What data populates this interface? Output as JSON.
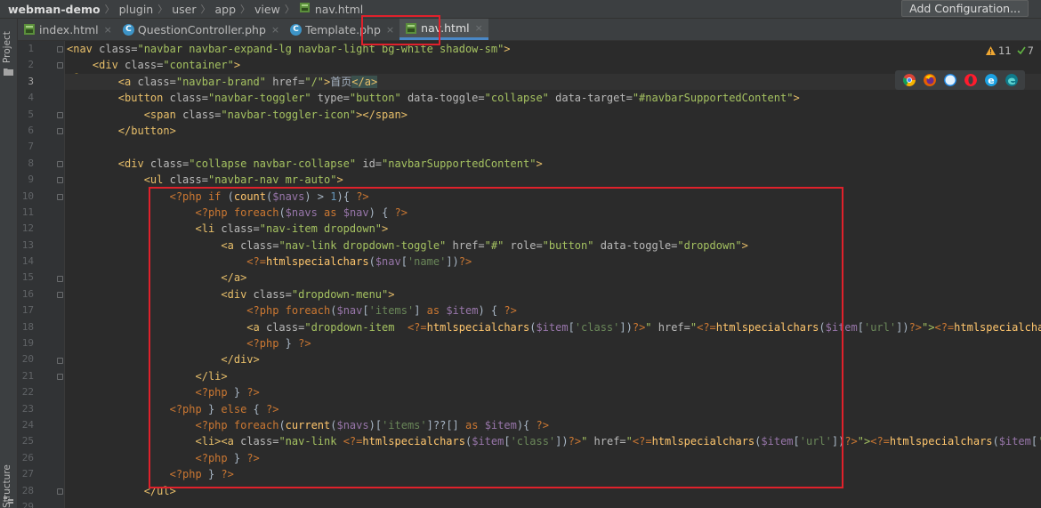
{
  "breadcrumb": {
    "items": [
      "webman-demo",
      "plugin",
      "user",
      "app",
      "view",
      "nav.html"
    ],
    "separator": "〉"
  },
  "toolbar": {
    "add_configuration_label": "Add Configuration..."
  },
  "tool_windows": {
    "project_label": "Project",
    "structure_label": "Structure"
  },
  "tabs": [
    {
      "label": "index.html",
      "icon": "html-file-icon",
      "active": false
    },
    {
      "label": "QuestionController.php",
      "icon": "php-class-icon",
      "active": false
    },
    {
      "label": "Template.php",
      "icon": "php-class-icon",
      "active": false
    },
    {
      "label": "nav.html",
      "icon": "html-file-icon",
      "active": true
    }
  ],
  "tab_close_glyph": "×",
  "inspection": {
    "warnings": "11",
    "ok": "7"
  },
  "browsers": [
    "chrome-icon",
    "firefox-icon",
    "safari-icon",
    "opera-icon",
    "ie-icon",
    "edge-icon"
  ],
  "editor": {
    "current_line": 3,
    "line_numbers": [
      "1",
      "2",
      "3",
      "4",
      "5",
      "6",
      "7",
      "8",
      "9",
      "10",
      "11",
      "12",
      "13",
      "14",
      "15",
      "16",
      "17",
      "18",
      "19",
      "20",
      "21",
      "22",
      "23",
      "24",
      "25",
      "26",
      "27",
      "28",
      "29"
    ],
    "lines": [
      [
        [
          "<nav ",
          "tg"
        ],
        [
          "class=",
          "at"
        ],
        [
          "\"navbar navbar-expand-lg navbar-light bg-white shadow-sm\"",
          "av"
        ],
        [
          ">",
          "tg"
        ]
      ],
      [
        [
          "    "
        ],
        [
          "<div ",
          "tg"
        ],
        [
          "class=",
          "at"
        ],
        [
          "\"container\"",
          "av"
        ],
        [
          ">",
          "tg"
        ]
      ],
      [
        [
          "        "
        ],
        [
          "<a ",
          "tg"
        ],
        [
          "class=",
          "at"
        ],
        [
          "\"navbar-brand\" ",
          "av"
        ],
        [
          "href=",
          "at"
        ],
        [
          "\"/\"",
          "av"
        ],
        [
          ">",
          "tg"
        ],
        [
          "首页",
          "tx"
        ],
        [
          "</a>",
          "tg hl"
        ]
      ],
      [
        [
          "        "
        ],
        [
          "<button ",
          "tg"
        ],
        [
          "class=",
          "at"
        ],
        [
          "\"navbar-toggler\" ",
          "av"
        ],
        [
          "type=",
          "at"
        ],
        [
          "\"button\" ",
          "av"
        ],
        [
          "data-toggle=",
          "at"
        ],
        [
          "\"collapse\" ",
          "av"
        ],
        [
          "data-target=",
          "at"
        ],
        [
          "\"#navbarSupportedContent\"",
          "av"
        ],
        [
          ">",
          "tg"
        ]
      ],
      [
        [
          "            "
        ],
        [
          "<span ",
          "tg"
        ],
        [
          "class=",
          "at"
        ],
        [
          "\"navbar-toggler-icon\"",
          "av"
        ],
        [
          "></span>",
          "tg"
        ]
      ],
      [
        [
          "        "
        ],
        [
          "</button>",
          "tg"
        ]
      ],
      [
        [
          ""
        ]
      ],
      [
        [
          "        "
        ],
        [
          "<div ",
          "tg"
        ],
        [
          "class=",
          "at"
        ],
        [
          "\"collapse navbar-collapse\" ",
          "av"
        ],
        [
          "id=",
          "at"
        ],
        [
          "\"navbarSupportedContent\"",
          "av"
        ],
        [
          ">",
          "tg"
        ]
      ],
      [
        [
          "            "
        ],
        [
          "<ul ",
          "tg"
        ],
        [
          "class=",
          "at"
        ],
        [
          "\"navbar-nav mr-auto\"",
          "av"
        ],
        [
          ">",
          "tg"
        ]
      ],
      [
        [
          "                "
        ],
        [
          "<?php ",
          "ph"
        ],
        [
          "if ",
          "kw"
        ],
        [
          "(",
          "tx"
        ],
        [
          "count",
          "fn"
        ],
        [
          "(",
          "tx"
        ],
        [
          "$navs",
          "vr"
        ],
        [
          ") > ",
          "tx"
        ],
        [
          "1",
          "nm"
        ],
        [
          "){ ",
          "tx"
        ],
        [
          "?>",
          "ph"
        ]
      ],
      [
        [
          "                    "
        ],
        [
          "<?php ",
          "ph"
        ],
        [
          "foreach",
          "kw"
        ],
        [
          "(",
          "tx"
        ],
        [
          "$navs ",
          "vr"
        ],
        [
          "as ",
          "kw"
        ],
        [
          "$nav",
          "vr"
        ],
        [
          ") { ",
          "tx"
        ],
        [
          "?>",
          "ph"
        ]
      ],
      [
        [
          "                    "
        ],
        [
          "<li ",
          "tg"
        ],
        [
          "class=",
          "at"
        ],
        [
          "\"nav-item dropdown\"",
          "av"
        ],
        [
          ">",
          "tg"
        ]
      ],
      [
        [
          "                        "
        ],
        [
          "<a ",
          "tg"
        ],
        [
          "class=",
          "at"
        ],
        [
          "\"nav-link dropdown-toggle\" ",
          "av"
        ],
        [
          "href=",
          "at"
        ],
        [
          "\"#\" ",
          "av"
        ],
        [
          "role=",
          "at"
        ],
        [
          "\"button\" ",
          "av"
        ],
        [
          "data-toggle=",
          "at"
        ],
        [
          "\"dropdown\"",
          "av"
        ],
        [
          ">",
          "tg"
        ]
      ],
      [
        [
          "                            "
        ],
        [
          "<?=",
          "ph"
        ],
        [
          "htmlspecialchars",
          "fn"
        ],
        [
          "(",
          "tx"
        ],
        [
          "$nav",
          "vr"
        ],
        [
          "[",
          "tx"
        ],
        [
          "'name'",
          "st"
        ],
        [
          "])",
          "tx"
        ],
        [
          "?>",
          "ph"
        ]
      ],
      [
        [
          "                        "
        ],
        [
          "</a>",
          "tg"
        ]
      ],
      [
        [
          "                        "
        ],
        [
          "<div ",
          "tg"
        ],
        [
          "class=",
          "at"
        ],
        [
          "\"dropdown-menu\"",
          "av"
        ],
        [
          ">",
          "tg"
        ]
      ],
      [
        [
          "                            "
        ],
        [
          "<?php ",
          "ph"
        ],
        [
          "foreach",
          "kw"
        ],
        [
          "(",
          "tx"
        ],
        [
          "$nav",
          "vr"
        ],
        [
          "[",
          "tx"
        ],
        [
          "'items'",
          "st"
        ],
        [
          "] ",
          "tx"
        ],
        [
          "as ",
          "kw"
        ],
        [
          "$item",
          "vr"
        ],
        [
          ") { ",
          "tx"
        ],
        [
          "?>",
          "ph"
        ]
      ],
      [
        [
          "                            "
        ],
        [
          "<a ",
          "tg"
        ],
        [
          "class=",
          "at"
        ],
        [
          "\"dropdown-item  ",
          "av"
        ],
        [
          "<?=",
          "ph"
        ],
        [
          "htmlspecialchars",
          "fn"
        ],
        [
          "(",
          "tx"
        ],
        [
          "$item",
          "vr"
        ],
        [
          "[",
          "tx"
        ],
        [
          "'class'",
          "st"
        ],
        [
          "])",
          "tx"
        ],
        [
          "?>",
          "ph"
        ],
        [
          "\" ",
          "av"
        ],
        [
          "href=",
          "at"
        ],
        [
          "\"",
          "av"
        ],
        [
          "<?=",
          "ph"
        ],
        [
          "htmlspecialchars",
          "fn"
        ],
        [
          "(",
          "tx"
        ],
        [
          "$item",
          "vr"
        ],
        [
          "[",
          "tx"
        ],
        [
          "'url'",
          "st"
        ],
        [
          "])",
          "tx"
        ],
        [
          "?>",
          "ph"
        ],
        [
          "\">",
          "av"
        ],
        [
          "<?=",
          "ph"
        ],
        [
          "htmlspecialchars",
          "fn"
        ],
        [
          "($",
          "tx"
        ]
      ],
      [
        [
          "                            "
        ],
        [
          "<?php ",
          "ph"
        ],
        [
          "} ",
          "tx"
        ],
        [
          "?>",
          "ph"
        ]
      ],
      [
        [
          "                        "
        ],
        [
          "</div>",
          "tg"
        ]
      ],
      [
        [
          "                    "
        ],
        [
          "</li>",
          "tg"
        ]
      ],
      [
        [
          "                    "
        ],
        [
          "<?php ",
          "ph"
        ],
        [
          "} ",
          "tx"
        ],
        [
          "?>",
          "ph"
        ]
      ],
      [
        [
          "                "
        ],
        [
          "<?php ",
          "ph"
        ],
        [
          "} ",
          "tx"
        ],
        [
          "else ",
          "kw"
        ],
        [
          "{ ",
          "tx"
        ],
        [
          "?>",
          "ph"
        ]
      ],
      [
        [
          "                    "
        ],
        [
          "<?php ",
          "ph"
        ],
        [
          "foreach",
          "kw"
        ],
        [
          "(",
          "tx"
        ],
        [
          "current",
          "fn"
        ],
        [
          "(",
          "tx"
        ],
        [
          "$navs",
          "vr"
        ],
        [
          ")[",
          "tx"
        ],
        [
          "'items'",
          "st"
        ],
        [
          "]??[] ",
          "tx"
        ],
        [
          "as ",
          "kw"
        ],
        [
          "$item",
          "vr"
        ],
        [
          "){ ",
          "tx"
        ],
        [
          "?>",
          "ph"
        ]
      ],
      [
        [
          "                    "
        ],
        [
          "<li>",
          "tg"
        ],
        [
          "<a ",
          "tg"
        ],
        [
          "class=",
          "at"
        ],
        [
          "\"nav-link ",
          "av"
        ],
        [
          "<?=",
          "ph"
        ],
        [
          "htmlspecialchars",
          "fn"
        ],
        [
          "(",
          "tx"
        ],
        [
          "$item",
          "vr"
        ],
        [
          "[",
          "tx"
        ],
        [
          "'class'",
          "st"
        ],
        [
          "])",
          "tx"
        ],
        [
          "?>",
          "ph"
        ],
        [
          "\" ",
          "av"
        ],
        [
          "href=",
          "at"
        ],
        [
          "\"",
          "av"
        ],
        [
          "<?=",
          "ph"
        ],
        [
          "htmlspecialchars",
          "fn"
        ],
        [
          "(",
          "tx"
        ],
        [
          "$item",
          "vr"
        ],
        [
          "[",
          "tx"
        ],
        [
          "'url'",
          "st"
        ],
        [
          "])",
          "tx"
        ],
        [
          "?>",
          "ph"
        ],
        [
          "\">",
          "av"
        ],
        [
          "<?=",
          "ph"
        ],
        [
          "htmlspecialchars",
          "fn"
        ],
        [
          "(",
          "tx"
        ],
        [
          "$item",
          "vr"
        ],
        [
          "[",
          "tx"
        ],
        [
          "'name",
          "st"
        ]
      ],
      [
        [
          "                    "
        ],
        [
          "<?php ",
          "ph"
        ],
        [
          "} ",
          "tx"
        ],
        [
          "?>",
          "ph"
        ]
      ],
      [
        [
          "                "
        ],
        [
          "<?php ",
          "ph"
        ],
        [
          "} ",
          "tx"
        ],
        [
          "?>",
          "ph"
        ]
      ],
      [
        [
          "            "
        ],
        [
          "</ul>",
          "tg"
        ]
      ],
      [
        [
          ""
        ]
      ]
    ]
  }
}
